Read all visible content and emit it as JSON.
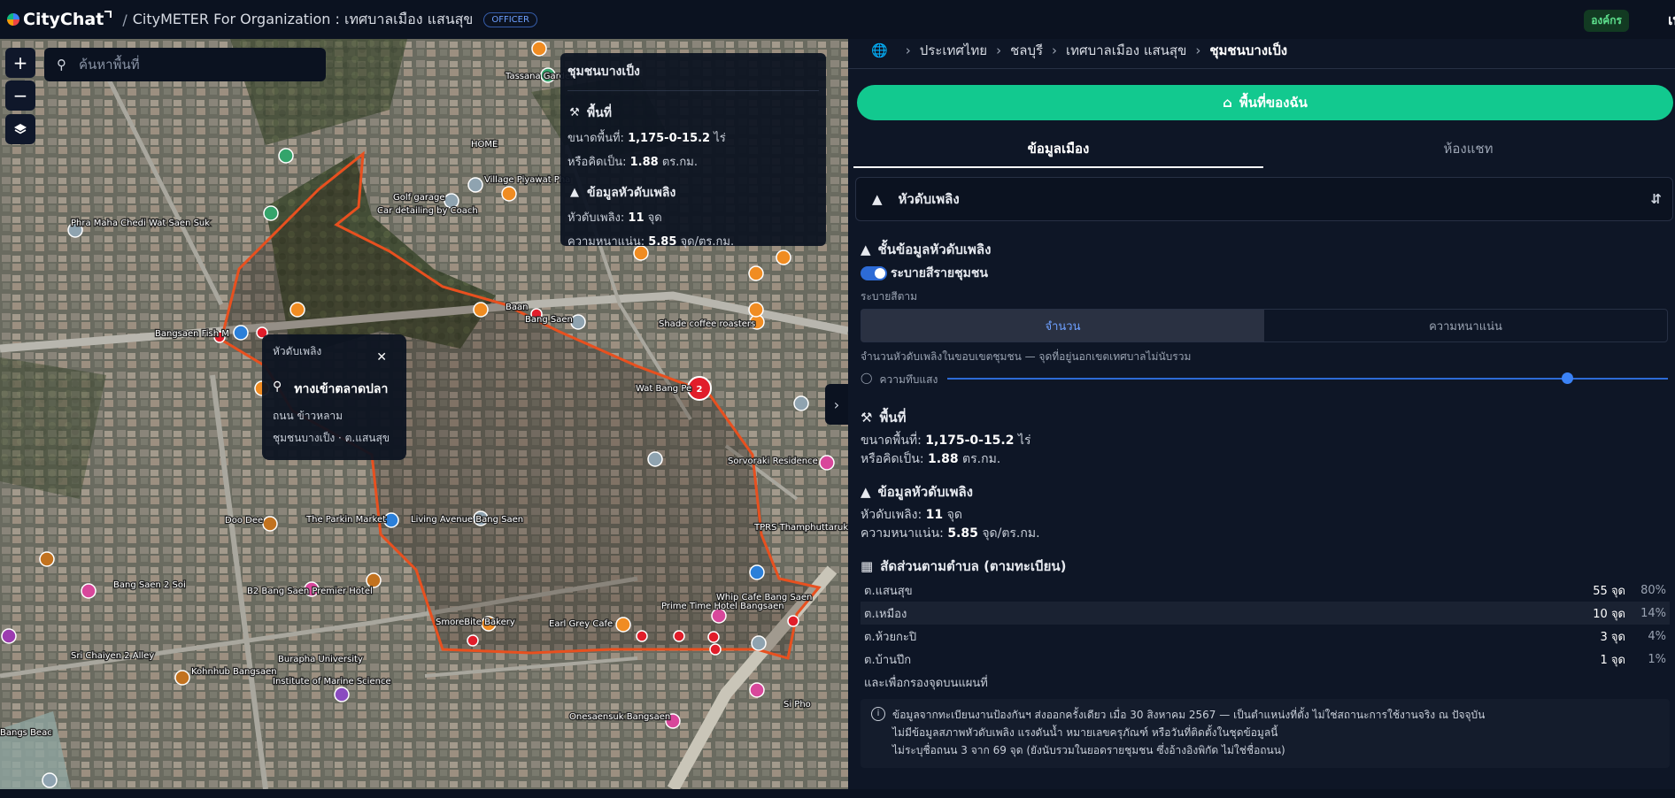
{
  "app": {
    "logo": "CityChat",
    "sep": "/",
    "title": "CityMETER For Organization : เทศบาลเมือง แสนสุข",
    "role_badge": "OFFICER",
    "org_badge": "องค์กร",
    "org_short": "เท"
  },
  "map": {
    "search_placeholder": "ค้นหาพื้นที่",
    "zoom_in": "+",
    "zoom_out": "−",
    "popup": {
      "title": "ชุมชนบางเป็ง",
      "area_heading": "พื้นที่",
      "area_label": "ขนาดพื้นที่:",
      "area_value": "1,175-0-15.2",
      "area_unit": "ไร่",
      "sqkm_label": "หรือคิดเป็น:",
      "sqkm_value": "1.88",
      "sqkm_unit": "ตร.กม.",
      "hyd_heading": "ข้อมูลหัวดับเพลิง",
      "hyd_label": "หัวดับเพลิง:",
      "hyd_value": "11",
      "hyd_unit": "จุด",
      "dens_label": "ความหนาแน่น:",
      "dens_value": "5.85",
      "dens_unit": "จุด/ตร.กม."
    },
    "hydrant_popup": {
      "title": "หัวดับเพลิง",
      "street_name": "ทางเข้าตลาดปลา",
      "road": "ถนน ข้าวหลาม",
      "community": "ชุมชนบางเป็ง · ต.แสนสุข"
    },
    "cluster_count": "2",
    "labels": [
      "Tassana Garden",
      "Phra Maha Chedi Wat Saen Suk",
      "Golf garage",
      "Village Piyawat Pha",
      "Bangsaen Fish M",
      "Baan",
      "Bang Saen",
      "Shade coffee roasters",
      "Wat Bang Pe",
      "Living Avenue Bang Saen",
      "The Parkin Market",
      "B2 Bang Saen Premier Hotel",
      "Doo Dee",
      "SmoreBite Bakery",
      "Earl Grey Cafe",
      "Prime Time Hotel Bangsaen",
      "Whip Cafe Bang Saen",
      "Sorvoraki Residence",
      "TPRS Thamphuttaruks Professional Window",
      "Burapha University",
      "Institute of Marine Science",
      "Onesaensuk Bangsaen",
      "Si Pho",
      "Bangs Beac",
      "Bang Saen 2 Soi",
      "Sri Chaiyen 2 Alley",
      "Kohnhub Bangsaen",
      "Car detailing by Coach",
      "HOME"
    ]
  },
  "panel": {
    "breadcrumb": [
      "ประเทศไทย",
      "ชลบุรี",
      "เทศบาลเมือง แสนสุข",
      "ชุมชนบางเป็ง"
    ],
    "my_area": "พื้นที่ของฉัน",
    "tabs": [
      "ข้อมูลเมือง",
      "ห้องแชท"
    ],
    "layer_selected": "หัวดับเพลิง",
    "layer_heading": "ชั้นข้อมูลหัวดับเพลิง",
    "toggle_label": "ระบายสีรายชุมชน",
    "color_by": "ระบายสีตาม",
    "seg": [
      "จำนวน",
      "ความหนาแน่น"
    ],
    "seg_note": "จำนวนหัวดับเพลิงในขอบเขตชุมชน — จุดที่อยู่นอกเขตเทศบาลไม่นับรวม",
    "opacity_label": "ความทึบแสง",
    "opacity_value": 0.86,
    "area_heading": "พื้นที่",
    "area_line": {
      "label": "ขนาดพื้นที่:",
      "value": "1,175-0-15.2",
      "unit": "ไร่"
    },
    "sqkm_line": {
      "label": "หรือคิดเป็น:",
      "value": "1.88",
      "unit": "ตร.กม."
    },
    "hyd_heading": "ข้อมูลหัวดับเพลิง",
    "hyd_line": {
      "label": "หัวดับเพลิง:",
      "value": "11",
      "unit": "จุด"
    },
    "dens_line": {
      "label": "ความหนาแน่น:",
      "value": "5.85",
      "unit": "จุด/ตร.กม."
    },
    "ratio_heading": "สัดส่วนตามตำบล (ตามทะเบียน)",
    "ratio_rows": [
      {
        "name": "ต.แสนสุข",
        "count": "55 จุด",
        "pct": "80%"
      },
      {
        "name": "ต.เหมือง",
        "count": "10 จุด",
        "pct": "14%"
      },
      {
        "name": "ต.ห้วยกะปิ",
        "count": "3 จุด",
        "pct": "4%"
      },
      {
        "name": "ต.บ้านปึก",
        "count": "1 จุด",
        "pct": "1%"
      }
    ],
    "ratio_foot": "และเพื่อกรองจุดบนแผนที่",
    "note": [
      "ข้อมูลจากทะเบียนงานป้องกันฯ ส่งออกครั้งเดียว เมื่อ 30 สิงหาคม 2567 — เป็นตำแหน่งที่ตั้ง ไม่ใช่สถานะการใช้งานจริง ณ ปัจจุบัน",
      "ไม่มีข้อมูลสภาพหัวดับเพลิง แรงดันน้ำ หมายเลขครุภัณฑ์ หรือวันที่ติดตั้งในชุดข้อมูลนี้",
      "ไม่ระบุชื่อถนน 3 จาก 69 จุด (ยังนับรวมในยอดรายชุมชน ซึ่งอ้างอิงพิกัด ไม่ใช่ชื่อถนน)"
    ]
  }
}
